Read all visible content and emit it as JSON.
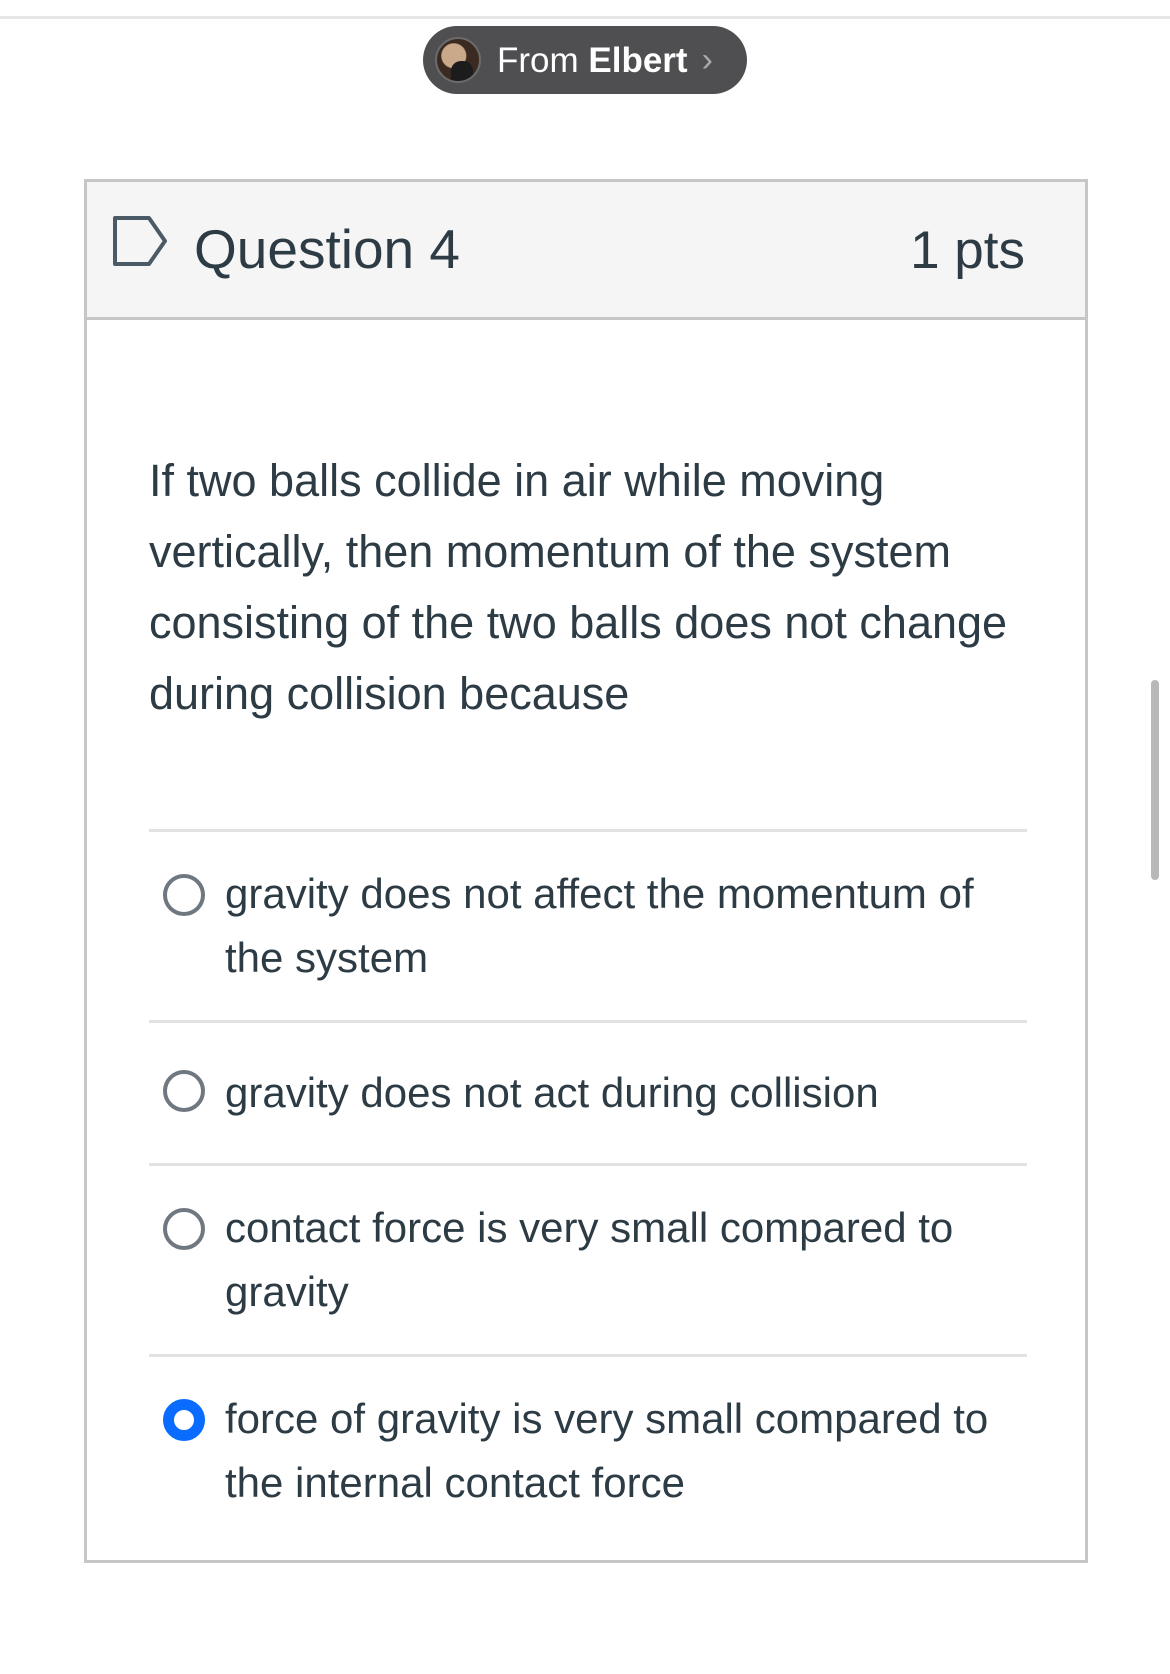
{
  "notification": {
    "from_label": "From",
    "sender_name": "Elbert",
    "chevron_icon": "chevron-right-icon"
  },
  "question": {
    "title": "Question 4",
    "points": "1 pts",
    "flag_icon": "flag-outline-icon",
    "text": "If two balls collide in air while moving vertically, then momentum of the system consisting of the two balls does not change during collision because",
    "answers": [
      {
        "label": "gravity does not affect the momentum of the system",
        "selected": false
      },
      {
        "label": "gravity does not act during collision",
        "selected": false
      },
      {
        "label": "contact force is very small compared to gravity",
        "selected": false
      },
      {
        "label": "force of gravity is very small compared to the internal contact force",
        "selected": true
      }
    ]
  },
  "colors": {
    "selected_radio": "#0a6cff",
    "text": "#2d3b45",
    "pill_background": "#4f4f51"
  }
}
